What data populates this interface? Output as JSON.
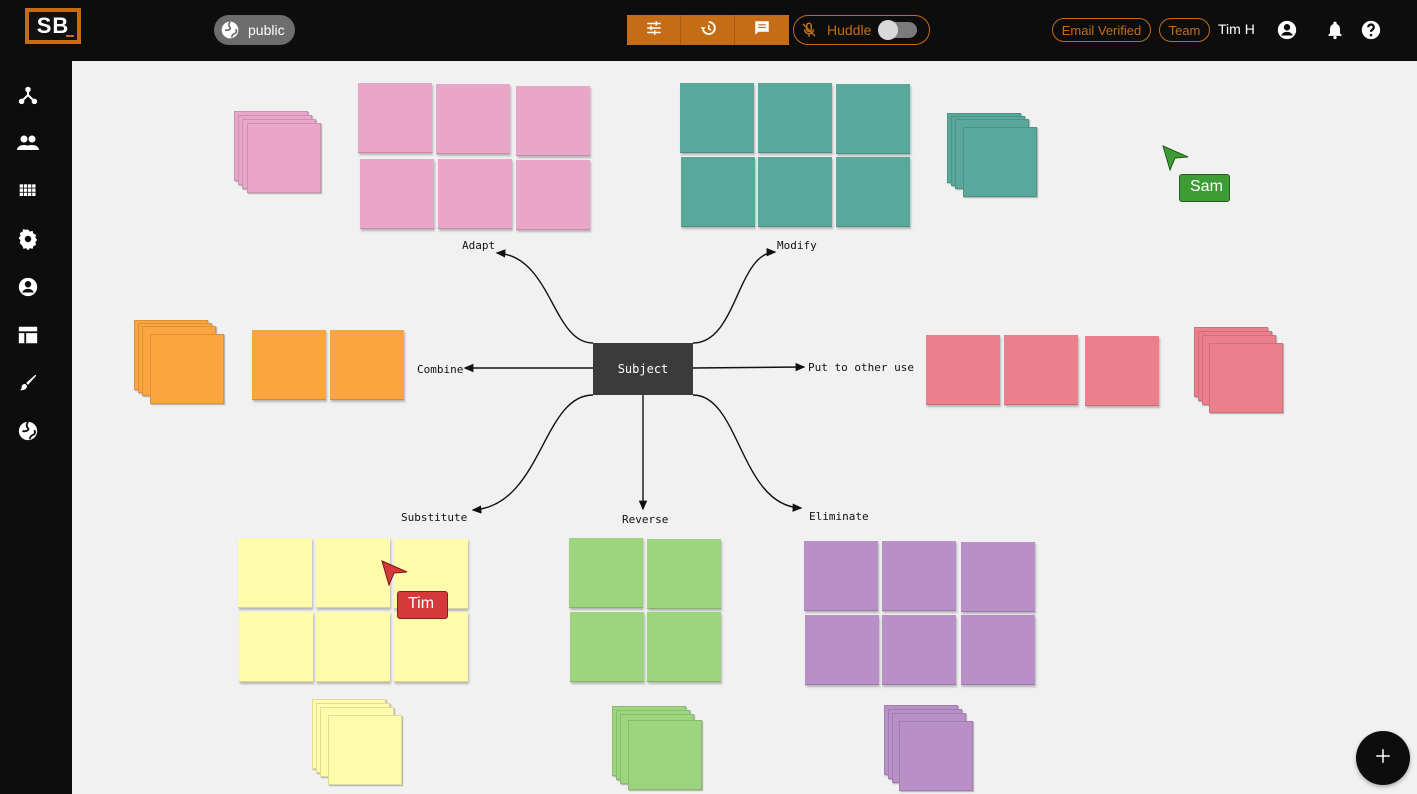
{
  "header": {
    "logo_text": "SB",
    "visibility_label": "public",
    "toolbar_icons": [
      "sliders-icon",
      "history-icon",
      "chat-icon"
    ],
    "huddle_label": "Huddle",
    "huddle_enabled": false,
    "email_status": "Email Verified",
    "team_label": "Team",
    "username": "Tim H",
    "accent_color": "#c46d16"
  },
  "sidebar": {
    "items": [
      {
        "icon": "graph-icon"
      },
      {
        "icon": "people-icon"
      },
      {
        "icon": "apps-grid-icon"
      },
      {
        "icon": "settings-gear-icon"
      },
      {
        "icon": "account-icon"
      },
      {
        "icon": "template-icon"
      },
      {
        "icon": "brush-icon"
      },
      {
        "icon": "globe-icon"
      }
    ]
  },
  "board": {
    "center_node": "Subject",
    "branches": [
      {
        "label": "Adapt",
        "color": "#e9a6c9"
      },
      {
        "label": "Modify",
        "color": "#58a89b"
      },
      {
        "label": "Combine",
        "color": "#fba540"
      },
      {
        "label": "Put to other use",
        "color": "#eb7f8c"
      },
      {
        "label": "Substitute",
        "color": "#fefcaa"
      },
      {
        "label": "Reverse",
        "color": "#9cd57e"
      },
      {
        "label": "Eliminate",
        "color": "#b98fc7"
      }
    ],
    "collaborators": [
      {
        "name": "Sam",
        "color": "#3e9c35"
      },
      {
        "name": "Tim",
        "color": "#d43a3a"
      }
    ]
  },
  "fab": {
    "icon": "plus-icon"
  }
}
